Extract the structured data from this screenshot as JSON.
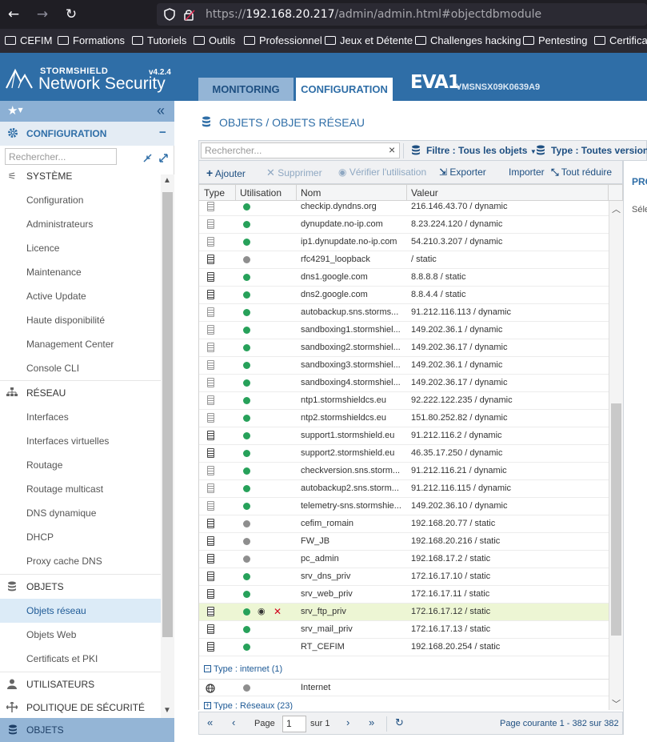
{
  "browser": {
    "url_prefix": "https://",
    "url_host": "192.168.20.217",
    "url_path": "/admin/admin.html#objectdbmodule",
    "back_glyph": "←",
    "forward_glyph": "→",
    "reload_glyph": "↻",
    "bookmarks": [
      "CEFIM",
      "Formations",
      "Tutoriels",
      "Outils",
      "Professionnel",
      "Jeux et Détente",
      "Challenges hacking",
      "Pentesting",
      "Certificat"
    ]
  },
  "header": {
    "brand": "STORMSHIELD",
    "product": "Network Security",
    "version": "v4.2.4",
    "tab_monitoring": "MONITORING",
    "tab_configuration": "CONFIGURATION",
    "device_name": "EVA1",
    "device_serial": "VMSNSX09K0639A9"
  },
  "sidebar": {
    "collapse_glyph": "«",
    "config_label": "CONFIGURATION",
    "config_toggle": "−",
    "search_placeholder": "Rechercher...",
    "section_partial": "SYSTÈME",
    "systeme_items": [
      "Configuration",
      "Administrateurs",
      "Licence",
      "Maintenance",
      "Active Update",
      "Haute disponibilité",
      "Management Center",
      "Console CLI"
    ],
    "reseau_label": "RÉSEAU",
    "reseau_items": [
      "Interfaces",
      "Interfaces virtuelles",
      "Routage",
      "Routage multicast",
      "DNS dynamique",
      "DHCP",
      "Proxy cache DNS"
    ],
    "objets_label": "OBJETS",
    "objets_items": [
      "Objets réseau",
      "Objets Web",
      "Certificats et PKI"
    ],
    "utilisateurs_label": "UTILISATEURS",
    "politique_label": "POLITIQUE DE SÉCURITÉ",
    "bottom_label": "OBJETS"
  },
  "main": {
    "title": "OBJETS / OBJETS RÉSEAU",
    "search_placeholder": "Rechercher...",
    "filter_label": "Filtre : Tous les objets",
    "type_label": "Type : Toutes versions d'",
    "actions": {
      "add": "Ajouter",
      "delete": "Supprimer",
      "check_usage": "Vérifier l'utilisation",
      "export": "Exporter",
      "import": "Importer",
      "collapse_all": "Tout réduire"
    },
    "columns": [
      "Type",
      "Utilisation",
      "Nom",
      "Valeur"
    ],
    "side_panel_title": "PRO",
    "side_panel_text": "Séle"
  },
  "rows": [
    {
      "name": "checkip.dyndns.org",
      "value": "216.146.43.70 / dynamic",
      "used": true,
      "dynamic": true
    },
    {
      "name": "dynupdate.no-ip.com",
      "value": "8.23.224.120 / dynamic",
      "used": true,
      "dynamic": true
    },
    {
      "name": "ip1.dynupdate.no-ip.com",
      "value": "54.210.3.207 / dynamic",
      "used": true,
      "dynamic": true
    },
    {
      "name": "rfc4291_loopback",
      "value": "/ static",
      "used": false,
      "dynamic": false
    },
    {
      "name": "dns1.google.com",
      "value": "8.8.8.8 / static",
      "used": true,
      "dynamic": false
    },
    {
      "name": "dns2.google.com",
      "value": "8.8.4.4 / static",
      "used": true,
      "dynamic": false
    },
    {
      "name": "autobackup.sns.storms...",
      "value": "91.212.116.113 / dynamic",
      "used": true,
      "dynamic": true
    },
    {
      "name": "sandboxing1.stormshiel...",
      "value": "149.202.36.1 / dynamic",
      "used": true,
      "dynamic": true
    },
    {
      "name": "sandboxing2.stormshiel...",
      "value": "149.202.36.17 / dynamic",
      "used": true,
      "dynamic": true
    },
    {
      "name": "sandboxing3.stormshiel...",
      "value": "149.202.36.1 / dynamic",
      "used": true,
      "dynamic": true
    },
    {
      "name": "sandboxing4.stormshiel...",
      "value": "149.202.36.17 / dynamic",
      "used": true,
      "dynamic": true
    },
    {
      "name": "ntp1.stormshieldcs.eu",
      "value": "92.222.122.235 / dynamic",
      "used": true,
      "dynamic": true
    },
    {
      "name": "ntp2.stormshieldcs.eu",
      "value": "151.80.252.82 / dynamic",
      "used": true,
      "dynamic": true
    },
    {
      "name": "support1.stormshield.eu",
      "value": "91.212.116.2 / dynamic",
      "used": true,
      "dynamic": false
    },
    {
      "name": "support2.stormshield.eu",
      "value": "46.35.17.250 / dynamic",
      "used": true,
      "dynamic": false
    },
    {
      "name": "checkversion.sns.storm...",
      "value": "91.212.116.21 / dynamic",
      "used": true,
      "dynamic": true
    },
    {
      "name": "autobackup2.sns.storm...",
      "value": "91.212.116.115 / dynamic",
      "used": true,
      "dynamic": true
    },
    {
      "name": "telemetry-sns.stormshie...",
      "value": "149.202.36.10 / dynamic",
      "used": true,
      "dynamic": true
    },
    {
      "name": "cefim_romain",
      "value": "192.168.20.77 / static",
      "used": false,
      "dynamic": false
    },
    {
      "name": "FW_JB",
      "value": "192.168.20.216 / static",
      "used": false,
      "dynamic": false
    },
    {
      "name": "pc_admin",
      "value": "192.168.17.2 / static",
      "used": false,
      "dynamic": false
    },
    {
      "name": "srv_dns_priv",
      "value": "172.16.17.10 / static",
      "used": true,
      "dynamic": false
    },
    {
      "name": "srv_web_priv",
      "value": "172.16.17.11 / static",
      "used": true,
      "dynamic": false
    },
    {
      "name": "srv_ftp_priv",
      "value": "172.16.17.12 / static",
      "used": true,
      "dynamic": false,
      "selected": true
    },
    {
      "name": "srv_mail_priv",
      "value": "172.16.17.13 / static",
      "used": true,
      "dynamic": false
    },
    {
      "name": "RT_CEFIM",
      "value": "192.168.20.254 / static",
      "used": true,
      "dynamic": false
    }
  ],
  "groups": {
    "internet_label": "Type : internet (1)",
    "internet_row": "Internet",
    "reseaux_label": "Type : Réseaux (23)"
  },
  "pager": {
    "page_label": "Page",
    "page_value": "1",
    "of_label": "sur 1",
    "status": "Page courante 1 - 382 sur 382"
  },
  "colors": {
    "header_blue": "#2f6ea7",
    "used_green": "#27a15a",
    "unused_gray": "#8e8e8e",
    "selected_row": "#edf6d4",
    "delete_red": "#d0021b"
  }
}
